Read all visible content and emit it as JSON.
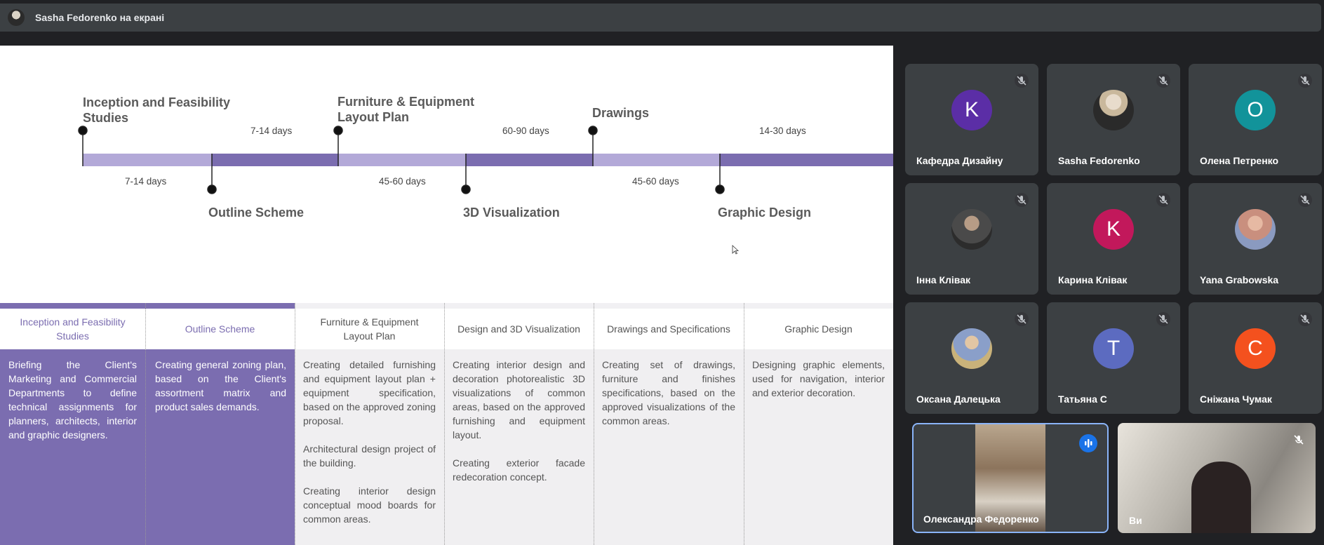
{
  "topbar": {
    "presenter_text": "Sasha Fedorenko на екрані"
  },
  "timeline": {
    "milestones": [
      {
        "title": "Inception and Feasibility Studies"
      },
      {
        "title": "Outline Scheme"
      },
      {
        "title": "Furniture & Equipment Layout Plan"
      },
      {
        "title": "3D Visualization"
      },
      {
        "title": "Drawings"
      },
      {
        "title": "Graphic Design"
      }
    ],
    "durations_above": [
      "7-14 days",
      "60-90 days",
      "14-30 days"
    ],
    "durations_below": [
      "7-14 days",
      "45-60 days",
      "45-60 days"
    ]
  },
  "table": {
    "headers": [
      "Inception and Feasibility Studies",
      "Outline Scheme",
      "Furniture & Equipment Layout Plan",
      "Design and 3D Visualization",
      "Drawings and Specifications",
      "Graphic Design"
    ],
    "col1": [
      "Briefing the Client's Marketing and Commercial Departments to define technical assignments for planners, architects, interior and graphic designers."
    ],
    "col2": [
      "Creating general zoning plan, based on the Client's assortment matrix and product sales demands."
    ],
    "col3": [
      "Creating detailed furnishing and equipment layout plan + equipment specification, based on the approved zoning proposal.",
      "Architectural design project of the building.",
      "Creating interior design conceptual mood boards for common areas."
    ],
    "col4": [
      "Creating interior design and decoration photorealistic 3D visualizations of common areas, based on the approved furnishing and equipment layout.",
      "Creating exterior facade redecoration concept."
    ],
    "col5": [
      "Creating set of drawings, furniture and finishes specifications, based on the approved visualizations of the common areas."
    ],
    "col6": [
      "Designing graphic elements, used for navigation, interior and exterior decoration."
    ]
  },
  "participants": [
    {
      "name": "Кафедра Дизайну",
      "letter": "K",
      "color": "#5b2ea6"
    },
    {
      "name": "Sasha Fedorenko",
      "letter": "",
      "color": ""
    },
    {
      "name": "Олена Петренко",
      "letter": "O",
      "color": "#12939a"
    },
    {
      "name": "Інна Клівак",
      "letter": "",
      "color": ""
    },
    {
      "name": "Карина Клівак",
      "letter": "K",
      "color": "#c2185b"
    },
    {
      "name": "Yana Grabowska",
      "letter": "",
      "color": ""
    },
    {
      "name": "Оксана Далецька",
      "letter": "",
      "color": ""
    },
    {
      "name": "Татьяна С",
      "letter": "T",
      "color": "#5c6bc0"
    },
    {
      "name": "Сніжана Чумак",
      "letter": "C",
      "color": "#f4511e"
    }
  ],
  "video_tiles": [
    {
      "name": "Олександра Федоренко"
    },
    {
      "name": "Ви"
    }
  ],
  "colors": {
    "accent_purple": "#7b6db0",
    "light_purple": "#b3a9d8",
    "speaking_blue": "#1a73e8"
  }
}
